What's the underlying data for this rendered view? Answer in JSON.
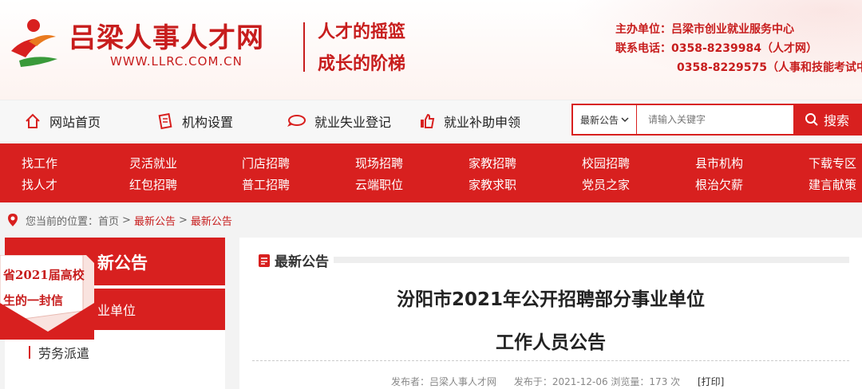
{
  "header": {
    "site_name": "吕梁人事人才网",
    "site_url": "WWW.LLRC.COM.CN",
    "slogan_line1": "人才的摇篮",
    "slogan_line2": "成长的阶梯",
    "host": "主办单位：吕梁市创业就业服务中心",
    "phone1": "联系电话：0358-8239984（人才网）",
    "phone2": "0358-8229575（人事和技能考试中",
    "brand_red": "#c71d1d"
  },
  "topnav": {
    "items": [
      {
        "label": "网站首页",
        "icon": "home-icon"
      },
      {
        "label": "机构设置",
        "icon": "document-icon"
      },
      {
        "label": "就业失业登记",
        "icon": "speech-bubble-icon"
      },
      {
        "label": "就业补助申领",
        "icon": "thumbs-up-icon"
      }
    ]
  },
  "search": {
    "category": "最新公告",
    "placeholder": "请输入关键字",
    "button_label": "搜索"
  },
  "rednav": {
    "row1": [
      "找工作",
      "灵活就业",
      "门店招聘",
      "现场招聘",
      "家教招聘",
      "校园招聘",
      "县市机构",
      "下载专区"
    ],
    "row2": [
      "找人才",
      "红包招聘",
      "普工招聘",
      "云端职位",
      "家教求职",
      "党员之家",
      "根治欠薪",
      "建言献策"
    ],
    "color": "#d8201f"
  },
  "breadcrumb": {
    "prefix": "您当前的位置：",
    "items": [
      "首页",
      "最新公告",
      "最新公告"
    ],
    "separator": ">"
  },
  "sidebar": {
    "title": "新公告",
    "active_item": "业单位",
    "item": "劳务派遣",
    "promo_line1": "省2021届高校",
    "promo_line2": "生的一封信"
  },
  "article": {
    "section_label": "最新公告",
    "title_line1": "汾阳市2021年公开招聘部分事业单位",
    "title_line2": "工作人员公告",
    "publisher": "发布者：吕梁人事人才网",
    "published": "发布于：2021-12-06",
    "views": "浏览量：173 次",
    "print": "[打印]"
  }
}
